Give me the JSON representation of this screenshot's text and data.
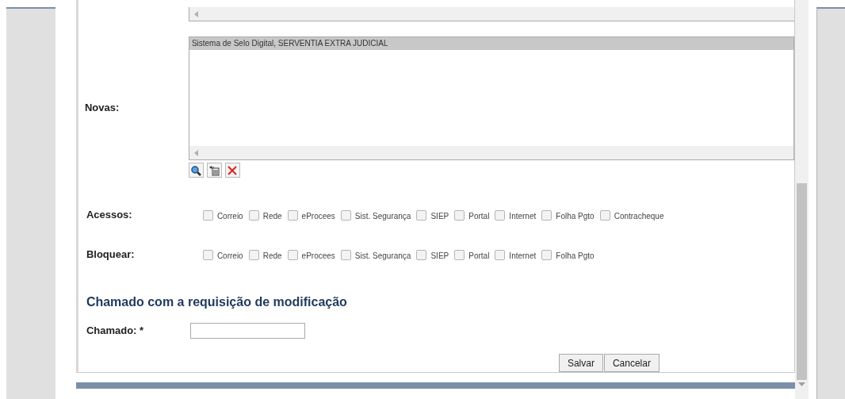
{
  "novas": {
    "label": "Novas:",
    "items": [
      {
        "label": "Sistema de Selo Digital, SERVENTIA EXTRA JUDICIAL",
        "selected": true
      }
    ]
  },
  "acessos": {
    "label": "Acessos:",
    "options": [
      {
        "label": "Correio",
        "checked": false
      },
      {
        "label": "Rede",
        "checked": false
      },
      {
        "label": "eProcees",
        "checked": false
      },
      {
        "label": "Sist. Segurança",
        "checked": false
      },
      {
        "label": "SIEP",
        "checked": false
      },
      {
        "label": "Portal",
        "checked": false
      },
      {
        "label": "Internet",
        "checked": false
      },
      {
        "label": "Folha Pgto",
        "checked": false
      },
      {
        "label": "Contracheque",
        "checked": false
      }
    ]
  },
  "bloquear": {
    "label": "Bloquear:",
    "options": [
      {
        "label": "Correio",
        "checked": false
      },
      {
        "label": "Rede",
        "checked": false
      },
      {
        "label": "eProcees",
        "checked": false
      },
      {
        "label": "Sist. Segurança",
        "checked": false
      },
      {
        "label": "SIEP",
        "checked": false
      },
      {
        "label": "Portal",
        "checked": false
      },
      {
        "label": "Internet",
        "checked": false
      },
      {
        "label": "Folha Pgto",
        "checked": false
      }
    ]
  },
  "section_title": "Chamado com a requisição de modificação",
  "chamado": {
    "label": "Chamado: *"
  },
  "buttons": [
    "Salvar",
    "Cancelar"
  ]
}
